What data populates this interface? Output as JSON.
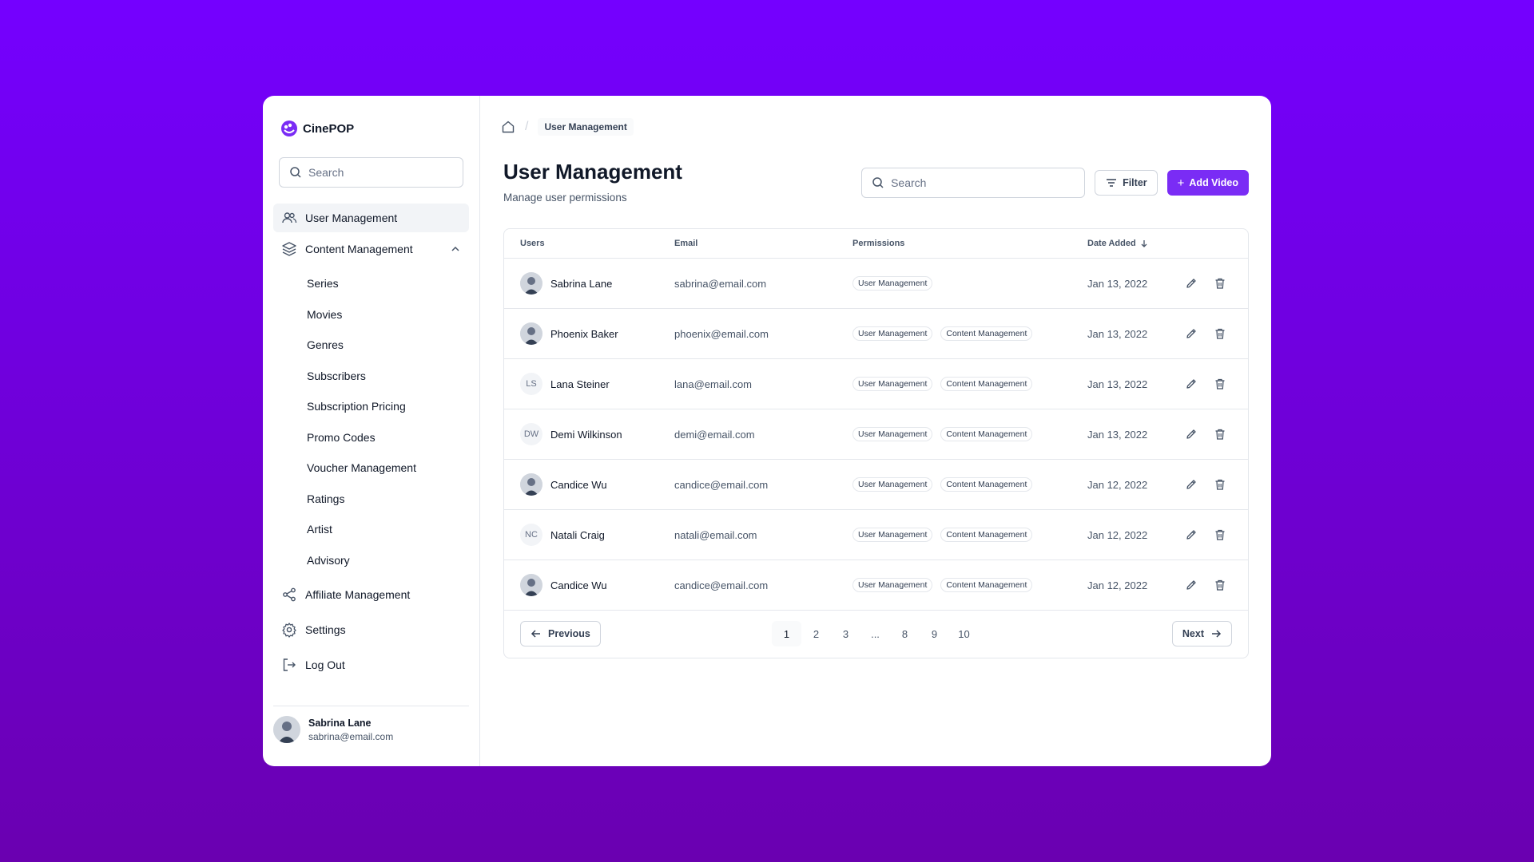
{
  "app": {
    "name": "CinePOP"
  },
  "sidebar": {
    "search_placeholder": "Search",
    "items": [
      {
        "label": "User Management",
        "icon": "users-icon"
      },
      {
        "label": "Content Management",
        "icon": "layers-icon"
      }
    ],
    "sub_items": [
      "Series",
      "Movies",
      "Genres",
      "Subscribers",
      "Subscription Pricing",
      "Promo Codes",
      "Voucher Management",
      "Ratings",
      "Artist",
      "Advisory"
    ],
    "bottom_items": [
      {
        "label": "Affiliate Management",
        "icon": "share-icon"
      },
      {
        "label": "Settings",
        "icon": "gear-icon"
      }
    ],
    "logout_label": "Log Out",
    "user": {
      "name": "Sabrina Lane",
      "email": "sabrina@email.com"
    }
  },
  "breadcrumb": {
    "current": "User Management"
  },
  "header": {
    "title": "User Management",
    "subtitle": "Manage user permissions",
    "search_placeholder": "Search",
    "filter_label": "Filter",
    "add_label": "Add Video"
  },
  "table": {
    "columns": {
      "users": "Users",
      "email": "Email",
      "permissions": "Permissions",
      "date": "Date Added"
    },
    "rows": [
      {
        "name": "Sabrina Lane",
        "initials": "",
        "email": "sabrina@email.com",
        "perms": [
          "User Management"
        ],
        "date": "Jan 13, 2022"
      },
      {
        "name": "Phoenix Baker",
        "initials": "",
        "email": "phoenix@email.com",
        "perms": [
          "User Management",
          "Content Management"
        ],
        "date": "Jan 13, 2022"
      },
      {
        "name": "Lana Steiner",
        "initials": "LS",
        "email": "lana@email.com",
        "perms": [
          "User Management",
          "Content Management"
        ],
        "date": "Jan 13, 2022"
      },
      {
        "name": "Demi Wilkinson",
        "initials": "DW",
        "email": "demi@email.com",
        "perms": [
          "User Management",
          "Content Management"
        ],
        "date": "Jan 13, 2022"
      },
      {
        "name": "Candice Wu",
        "initials": "",
        "email": "candice@email.com",
        "perms": [
          "User Management",
          "Content Management"
        ],
        "date": "Jan 12, 2022"
      },
      {
        "name": "Natali Craig",
        "initials": "NC",
        "email": "natali@email.com",
        "perms": [
          "User Management",
          "Content Management"
        ],
        "date": "Jan 12, 2022"
      },
      {
        "name": "Candice Wu",
        "initials": "",
        "email": "candice@email.com",
        "perms": [
          "User Management",
          "Content Management"
        ],
        "date": "Jan 12, 2022"
      }
    ]
  },
  "pagination": {
    "prev_label": "Previous",
    "next_label": "Next",
    "pages": [
      "1",
      "2",
      "3",
      "...",
      "8",
      "9",
      "10"
    ],
    "current": "1"
  },
  "colors": {
    "accent": "#7a2cf5",
    "background_top": "#7400ff",
    "background_bottom": "#6a00b0"
  }
}
